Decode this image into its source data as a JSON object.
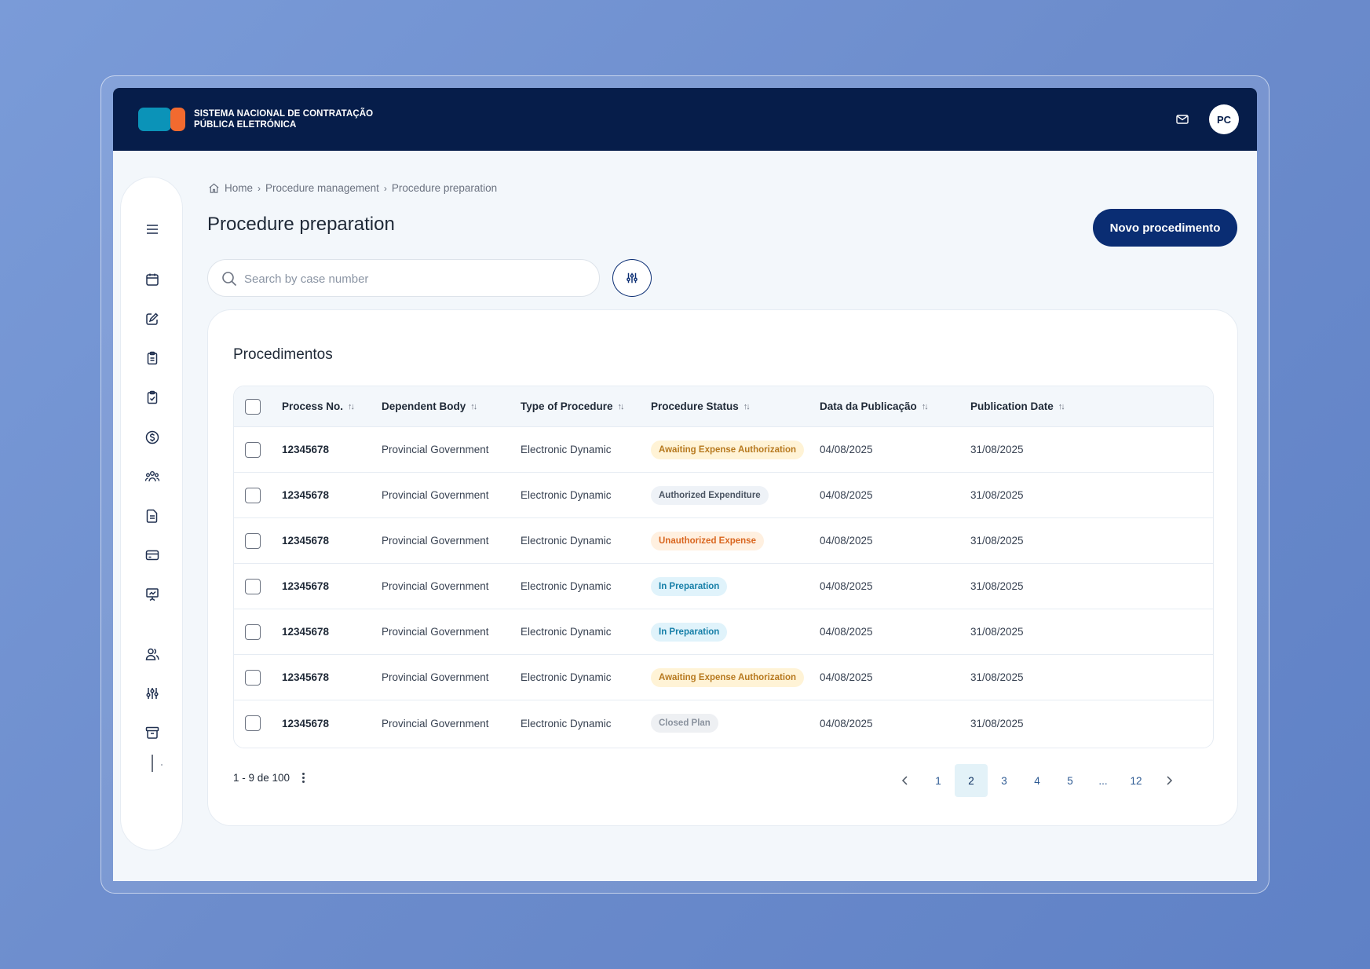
{
  "header": {
    "brand_line1": "SISTEMA NACIONAL DE CONTRATAÇÃO",
    "brand_line2": "PÚBLICA ELETRÓNICA",
    "avatar_initials": "PC",
    "colors": {
      "topbar": "#061d4a",
      "logo_blue": "#0b93b8",
      "logo_orange": "#f26a2f"
    }
  },
  "sidebar": {
    "items": [
      "menu-icon",
      "calendar-icon",
      "edit-icon",
      "clipboard-icon",
      "clipboard-check-icon",
      "dollar-icon",
      "team-icon",
      "document-icon",
      "card-icon",
      "presentation-icon",
      "users-icon",
      "sliders-icon",
      "archive-icon"
    ]
  },
  "breadcrumb": {
    "home": "Home",
    "level1": "Procedure management",
    "level2": "Procedure preparation"
  },
  "page": {
    "title": "Procedure preparation",
    "new_button": "Novo procedimento"
  },
  "search": {
    "placeholder": "Search by case number",
    "value": ""
  },
  "table": {
    "title": "Procedimentos",
    "columns": [
      "Process No.",
      "Dependent Body",
      "Type of Procedure",
      "Procedure Status",
      "Data da Publicação",
      "Publication Date"
    ],
    "rows": [
      {
        "process_no": "12345678",
        "body": "Provincial Government",
        "type": "Electronic Dynamic",
        "status": "Awaiting Expense Authorization",
        "status_kind": "await",
        "data_publicacao": "04/08/2025",
        "publication_date": "31/08/2025"
      },
      {
        "process_no": "12345678",
        "body": "Provincial Government",
        "type": "Electronic Dynamic",
        "status": "Authorized Expenditure",
        "status_kind": "auth",
        "data_publicacao": "04/08/2025",
        "publication_date": "31/08/2025"
      },
      {
        "process_no": "12345678",
        "body": "Provincial Government",
        "type": "Electronic Dynamic",
        "status": "Unauthorized Expense",
        "status_kind": "unauth",
        "data_publicacao": "04/08/2025",
        "publication_date": "31/08/2025"
      },
      {
        "process_no": "12345678",
        "body": "Provincial Government",
        "type": "Electronic Dynamic",
        "status": "In Preparation",
        "status_kind": "prep",
        "data_publicacao": "04/08/2025",
        "publication_date": "31/08/2025"
      },
      {
        "process_no": "12345678",
        "body": "Provincial Government",
        "type": "Electronic Dynamic",
        "status": "In Preparation",
        "status_kind": "prep",
        "data_publicacao": "04/08/2025",
        "publication_date": "31/08/2025"
      },
      {
        "process_no": "12345678",
        "body": "Provincial Government",
        "type": "Electronic Dynamic",
        "status": "Awaiting Expense Authorization",
        "status_kind": "await",
        "data_publicacao": "04/08/2025",
        "publication_date": "31/08/2025"
      },
      {
        "process_no": "12345678",
        "body": "Provincial Government",
        "type": "Electronic Dynamic",
        "status": "Closed Plan",
        "status_kind": "closed",
        "data_publicacao": "04/08/2025",
        "publication_date": "31/08/2025"
      }
    ]
  },
  "pagination": {
    "range_text": "1 - 9 de 100",
    "pages": [
      "1",
      "2",
      "3",
      "4",
      "5",
      "...",
      "12"
    ],
    "current": "2"
  }
}
